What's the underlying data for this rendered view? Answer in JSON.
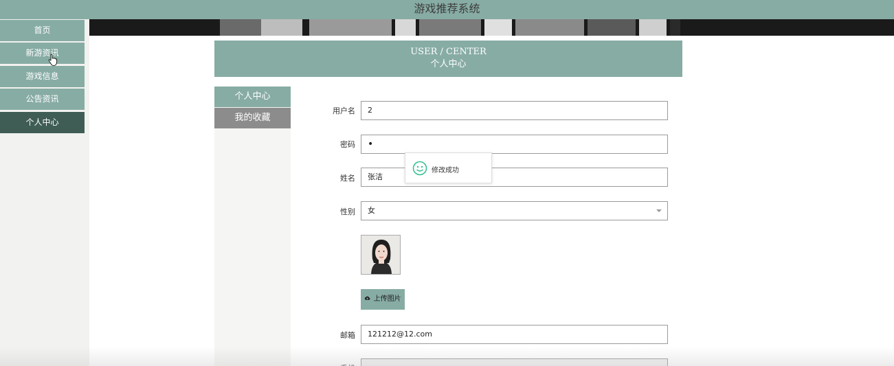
{
  "header": {
    "title": "游戏推荐系统"
  },
  "sidebar": {
    "items": [
      {
        "label": "首页"
      },
      {
        "label": "新游资讯"
      },
      {
        "label": "游戏信息"
      },
      {
        "label": "公告资讯"
      },
      {
        "label": "个人中心"
      }
    ],
    "active_index": 4
  },
  "user_center": {
    "title_en": "USER / CENTER",
    "title_cn": "个人中心"
  },
  "subnav": {
    "items": [
      {
        "label": "个人中心"
      },
      {
        "label": "我的收藏"
      }
    ]
  },
  "form": {
    "username": {
      "label": "用户名",
      "value": "2"
    },
    "password": {
      "label": "密码",
      "value": "•"
    },
    "name": {
      "label": "姓名",
      "value": "张洁"
    },
    "gender": {
      "label": "性别",
      "value": "女"
    },
    "upload_label": "上传图片",
    "email": {
      "label": "邮箱",
      "value": "121212@12.com"
    },
    "phone": {
      "label": "手机"
    }
  },
  "toast": {
    "message": "修改成功"
  },
  "colors": {
    "accent": "#87aca4",
    "nav_active": "#3f5d55",
    "subnav_inactive": "#8c8c8c",
    "success": "#2dbf8f"
  },
  "icons": {
    "upload": "cloud-upload-icon",
    "toast": "smile-icon",
    "select": "chevron-down-icon"
  }
}
